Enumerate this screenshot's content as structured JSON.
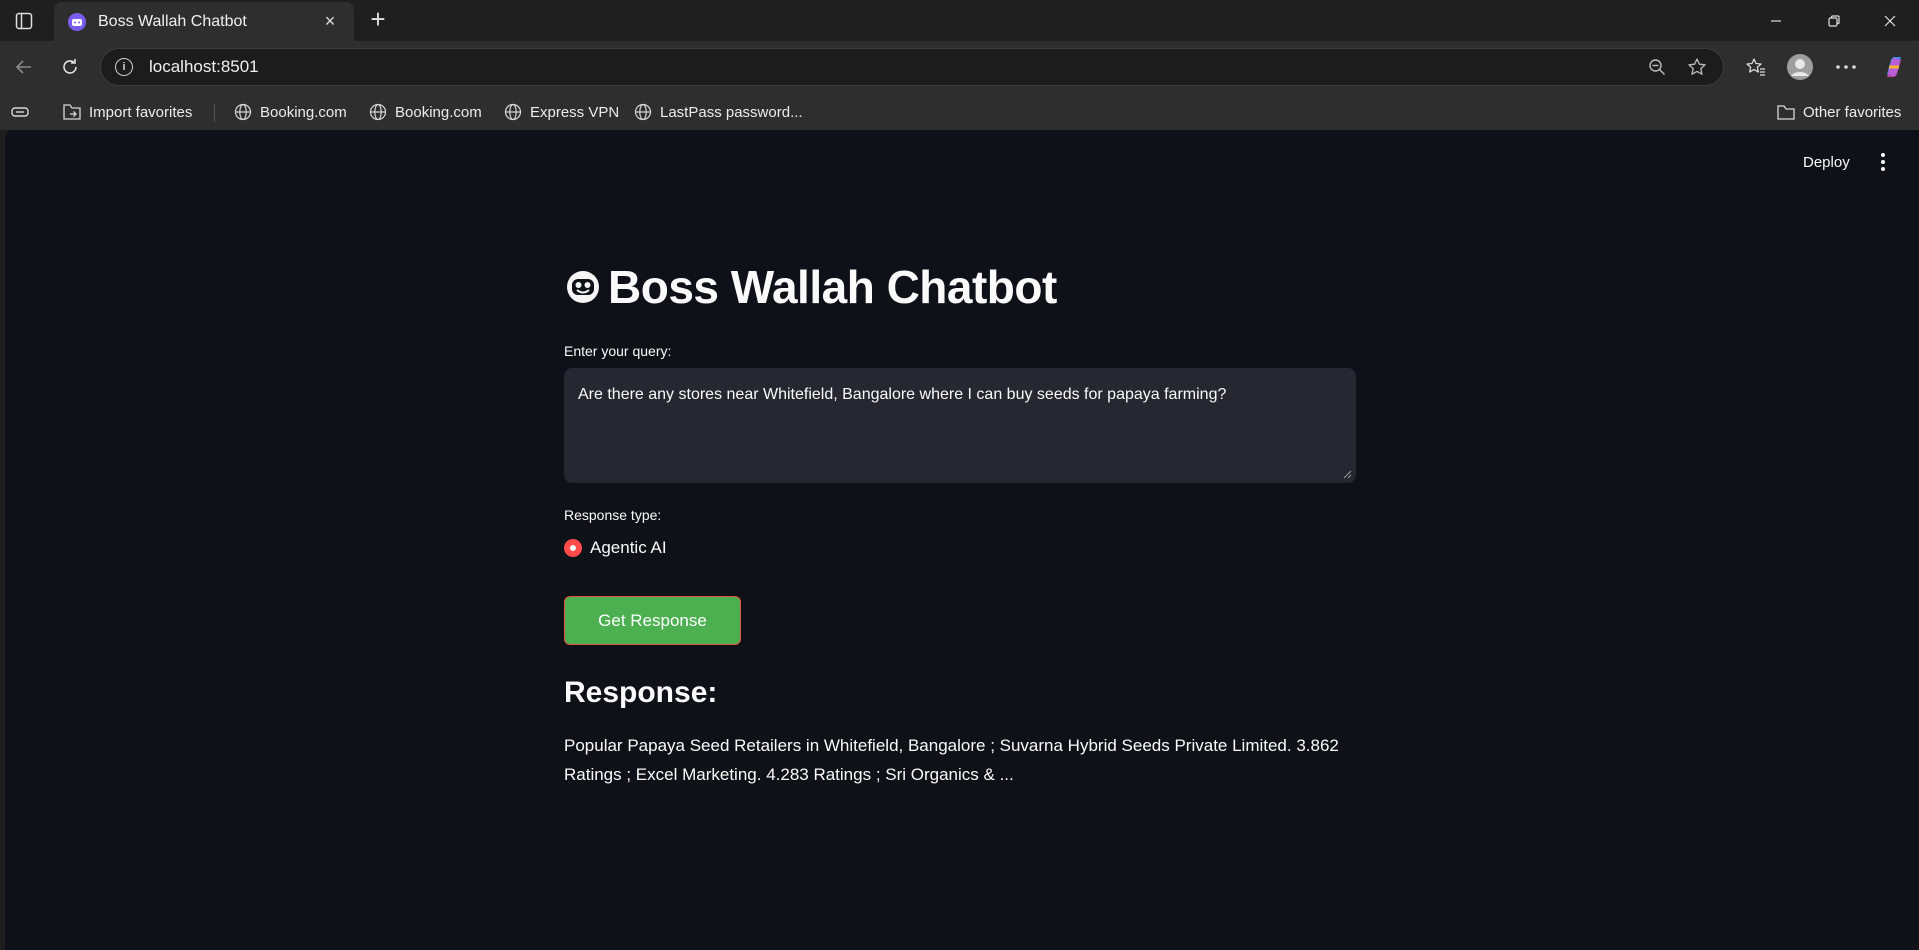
{
  "browser": {
    "tab_title": "Boss Wallah Chatbot",
    "tab_close": "×",
    "new_tab": "+",
    "url": "localhost:8501"
  },
  "bookmarks": {
    "import": "Import favorites",
    "items": [
      "Booking.com",
      "Booking.com",
      "Express VPN",
      "LastPass password..."
    ],
    "other": "Other favorites"
  },
  "app": {
    "deploy_label": "Deploy",
    "title": "Boss Wallah Chatbot",
    "query_label": "Enter your query:",
    "query_value": "Are there any stores near Whitefield, Bangalore where I can buy seeds for papaya farming?",
    "response_type_label": "Response type:",
    "response_type_option": "Agentic AI",
    "button_label": "Get Response",
    "response_heading": "Response:",
    "response_text": "Popular Papaya Seed Retailers in Whitefield, Bangalore ; Suvarna Hybrid Seeds Private Limited. 3.862 Ratings ; Excel Marketing. 4.283 Ratings ; Sri Organics & ..."
  },
  "colors": {
    "page_bg": "#0e1117",
    "input_bg": "#262730",
    "radio_accent": "#ff4b4b",
    "button_bg": "#4caf50",
    "button_border": "#e0553c"
  }
}
